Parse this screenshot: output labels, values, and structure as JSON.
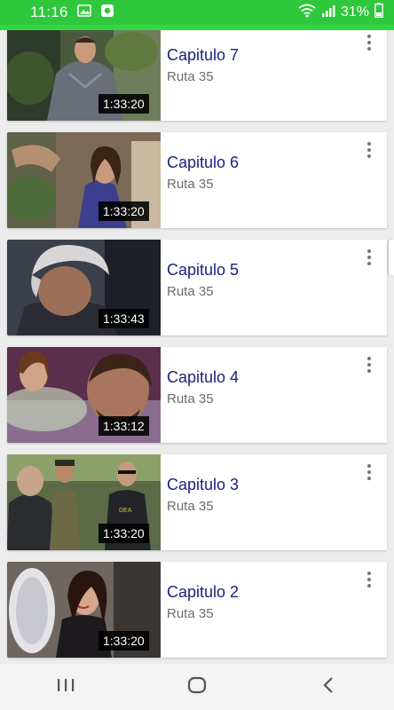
{
  "status_bar": {
    "time": "11:16",
    "battery": "31%",
    "icons": [
      "gallery-icon",
      "notification-icon",
      "wifi-icon",
      "signal-icon",
      "battery-icon"
    ]
  },
  "colors": {
    "status_bar": "#2fc73b",
    "title": "#1a237e",
    "subtitle": "#6b6b6b"
  },
  "videos": [
    {
      "title": "Capitulo 7",
      "subtitle": "Ruta 35",
      "duration": "1:33:20"
    },
    {
      "title": "Capitulo 6",
      "subtitle": "Ruta 35",
      "duration": "1:33:20"
    },
    {
      "title": "Capitulo 5",
      "subtitle": "Ruta 35",
      "duration": "1:33:43"
    },
    {
      "title": "Capitulo 4",
      "subtitle": "Ruta 35",
      "duration": "1:33:12"
    },
    {
      "title": "Capitulo 3",
      "subtitle": "Ruta 35",
      "duration": "1:33:20"
    },
    {
      "title": "Capitulo 2",
      "subtitle": "Ruta 35",
      "duration": "1:33:20"
    }
  ],
  "nav_bar": {
    "buttons": [
      "recent-apps-icon",
      "home-icon",
      "back-icon"
    ]
  }
}
